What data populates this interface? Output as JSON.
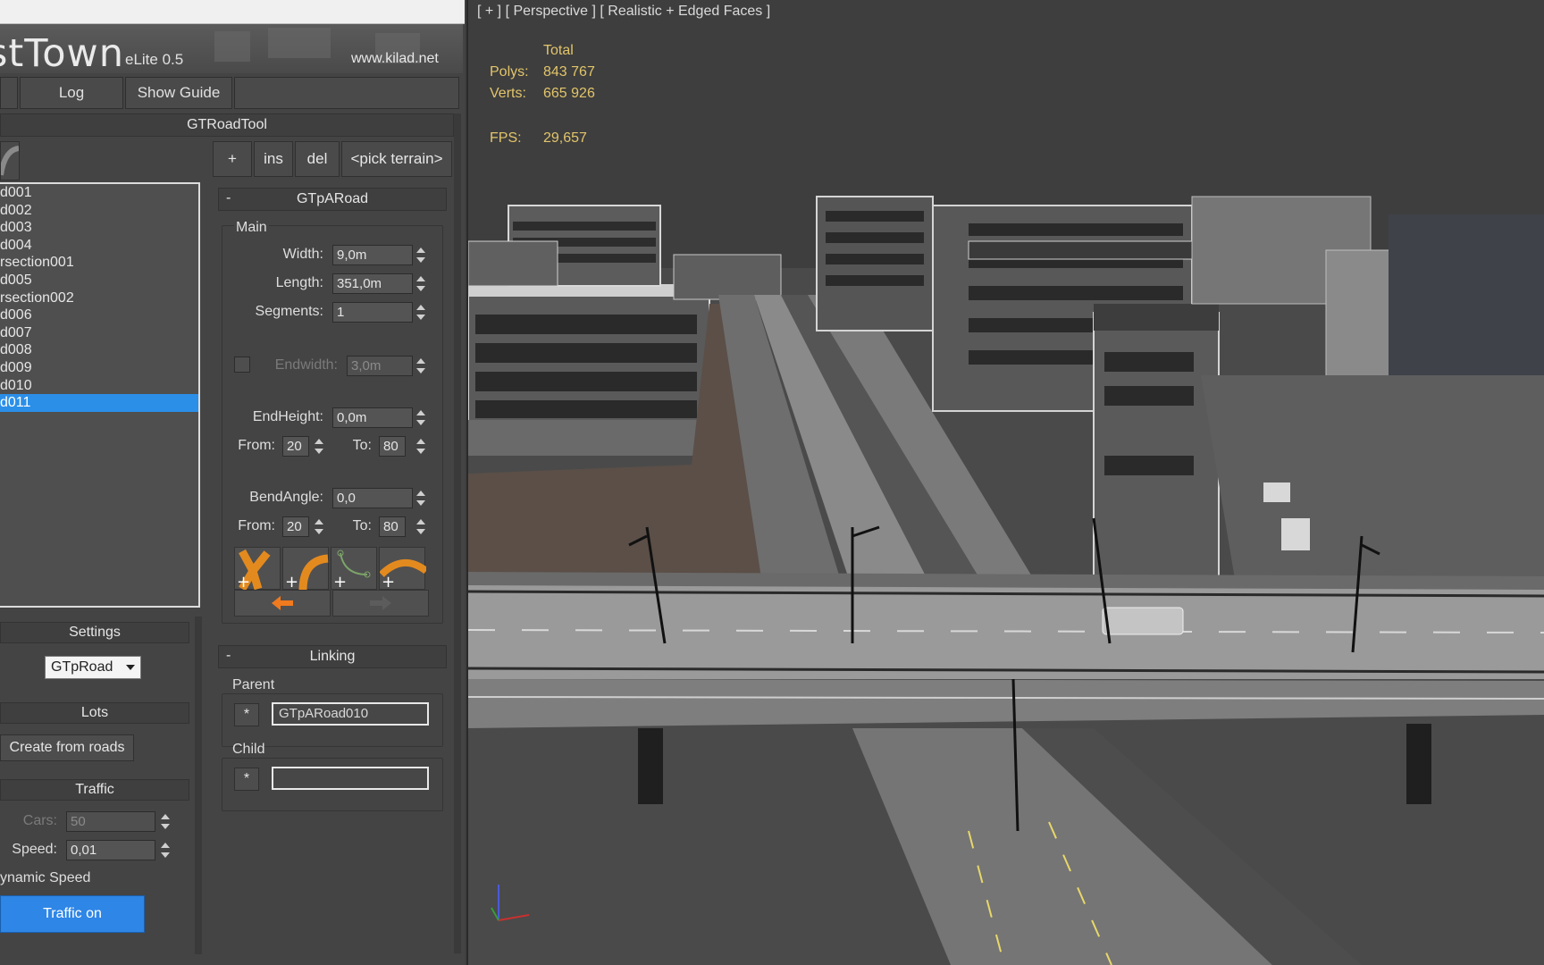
{
  "panel": {
    "brand": "stTown",
    "version": "eLite 0.5",
    "website": "www.kilad.net",
    "top_buttons": [
      "Log",
      "Show Guide"
    ],
    "tool_title": "GTRoadTool",
    "edit_buttons": [
      "+",
      "ins",
      "del",
      "<pick terrain>"
    ],
    "road_list": [
      "d001",
      "d002",
      "d003",
      "d004",
      "rsection001",
      "d005",
      "rsection002",
      "d006",
      "d007",
      "d008",
      "d009",
      "d010",
      "d011"
    ],
    "road_list_selected": "d011",
    "settings": {
      "title": "Settings",
      "dropdown_value": "GTpRoad"
    },
    "lots": {
      "title": "Lots",
      "create_label": "Create from roads"
    },
    "traffic": {
      "title": "Traffic",
      "cars_label": "Cars:",
      "cars_value": "50",
      "speed_label": "Speed:",
      "speed_value": "0,01",
      "dynamic_speed": "ynamic Speed",
      "traffic_button": "Traffic on"
    },
    "road": {
      "title": "GTpARoad",
      "collapse": "-",
      "main_title": "Main",
      "width_label": "Width:",
      "width_value": "9,0m",
      "length_label": "Length:",
      "length_value": "351,0m",
      "segments_label": "Segments:",
      "segments_value": "1",
      "endwidth_label": "Endwidth:",
      "endwidth_value": "3,0m",
      "endheight_label": "EndHeight:",
      "endheight_value": "0,0m",
      "from_label": "From:",
      "to_label": "To:",
      "from1": "20",
      "to1": "80",
      "bendangle_label": "BendAngle:",
      "bendangle_value": "0,0",
      "from2": "20",
      "to2": "80"
    },
    "linking": {
      "title": "Linking",
      "collapse": "-",
      "parent_label": "Parent",
      "parent_value": "GTpARoad010",
      "parent_pick": "*",
      "child_label": "Child",
      "child_value": "",
      "child_pick": "*"
    }
  },
  "viewport": {
    "label": "[ + ] [ Perspective ] [ Realistic + Edged Faces ]",
    "stats": {
      "header": "Total",
      "polys_label": "Polys:",
      "polys_value": "843 767",
      "verts_label": "Verts:",
      "verts_value": "665 926",
      "fps_label": "FPS:",
      "fps_value": "29,657"
    }
  },
  "colors": {
    "accent": "#2e86e6",
    "stats_text": "#e2c56a",
    "selection": "#2b8fe8"
  }
}
